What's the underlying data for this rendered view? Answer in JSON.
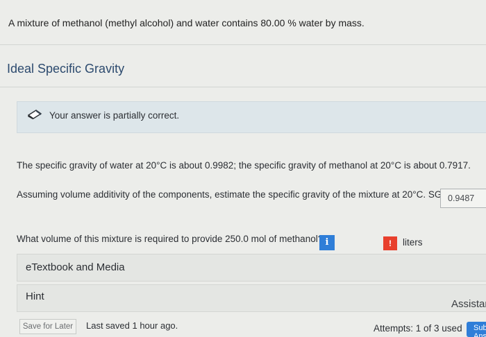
{
  "question_text": "A mixture of methanol (methyl alcohol) and water contains 80.00 % water by mass.",
  "section_title": "Ideal Specific Gravity",
  "feedback": {
    "icon": "pencil-icon",
    "message": "Your answer is partially correct."
  },
  "part1": {
    "line1": "The specific gravity of water at 20°C is about 0.9982; the specific gravity of methanol at 20°C is about 0.7917.",
    "line2": "Assuming volume additivity of the components, estimate the specific gravity of the mixture at 20°C. SG =",
    "sg_value": "0.9487"
  },
  "part2": {
    "question": "What volume of this mixture is required to provide 250.0 mol of methanol?",
    "info_icon_label": "i",
    "warning_icon_label": "!",
    "answer_value": "",
    "units": "liters"
  },
  "panels": {
    "etextbook": "eTextbook and Media",
    "hint": "Hint",
    "assistance": "Assistance"
  },
  "footer": {
    "save_label": "Save for Later",
    "last_saved": "Last saved 1 hour ago.",
    "attempts": "Attempts: 1 of 3 used",
    "submit_label": "Submit Answer"
  },
  "colors": {
    "accent_blue": "#2f7ed8",
    "warning_red": "#e8402d",
    "title_blue": "#2c4a6e",
    "feedback_bg": "#dde6ea"
  }
}
